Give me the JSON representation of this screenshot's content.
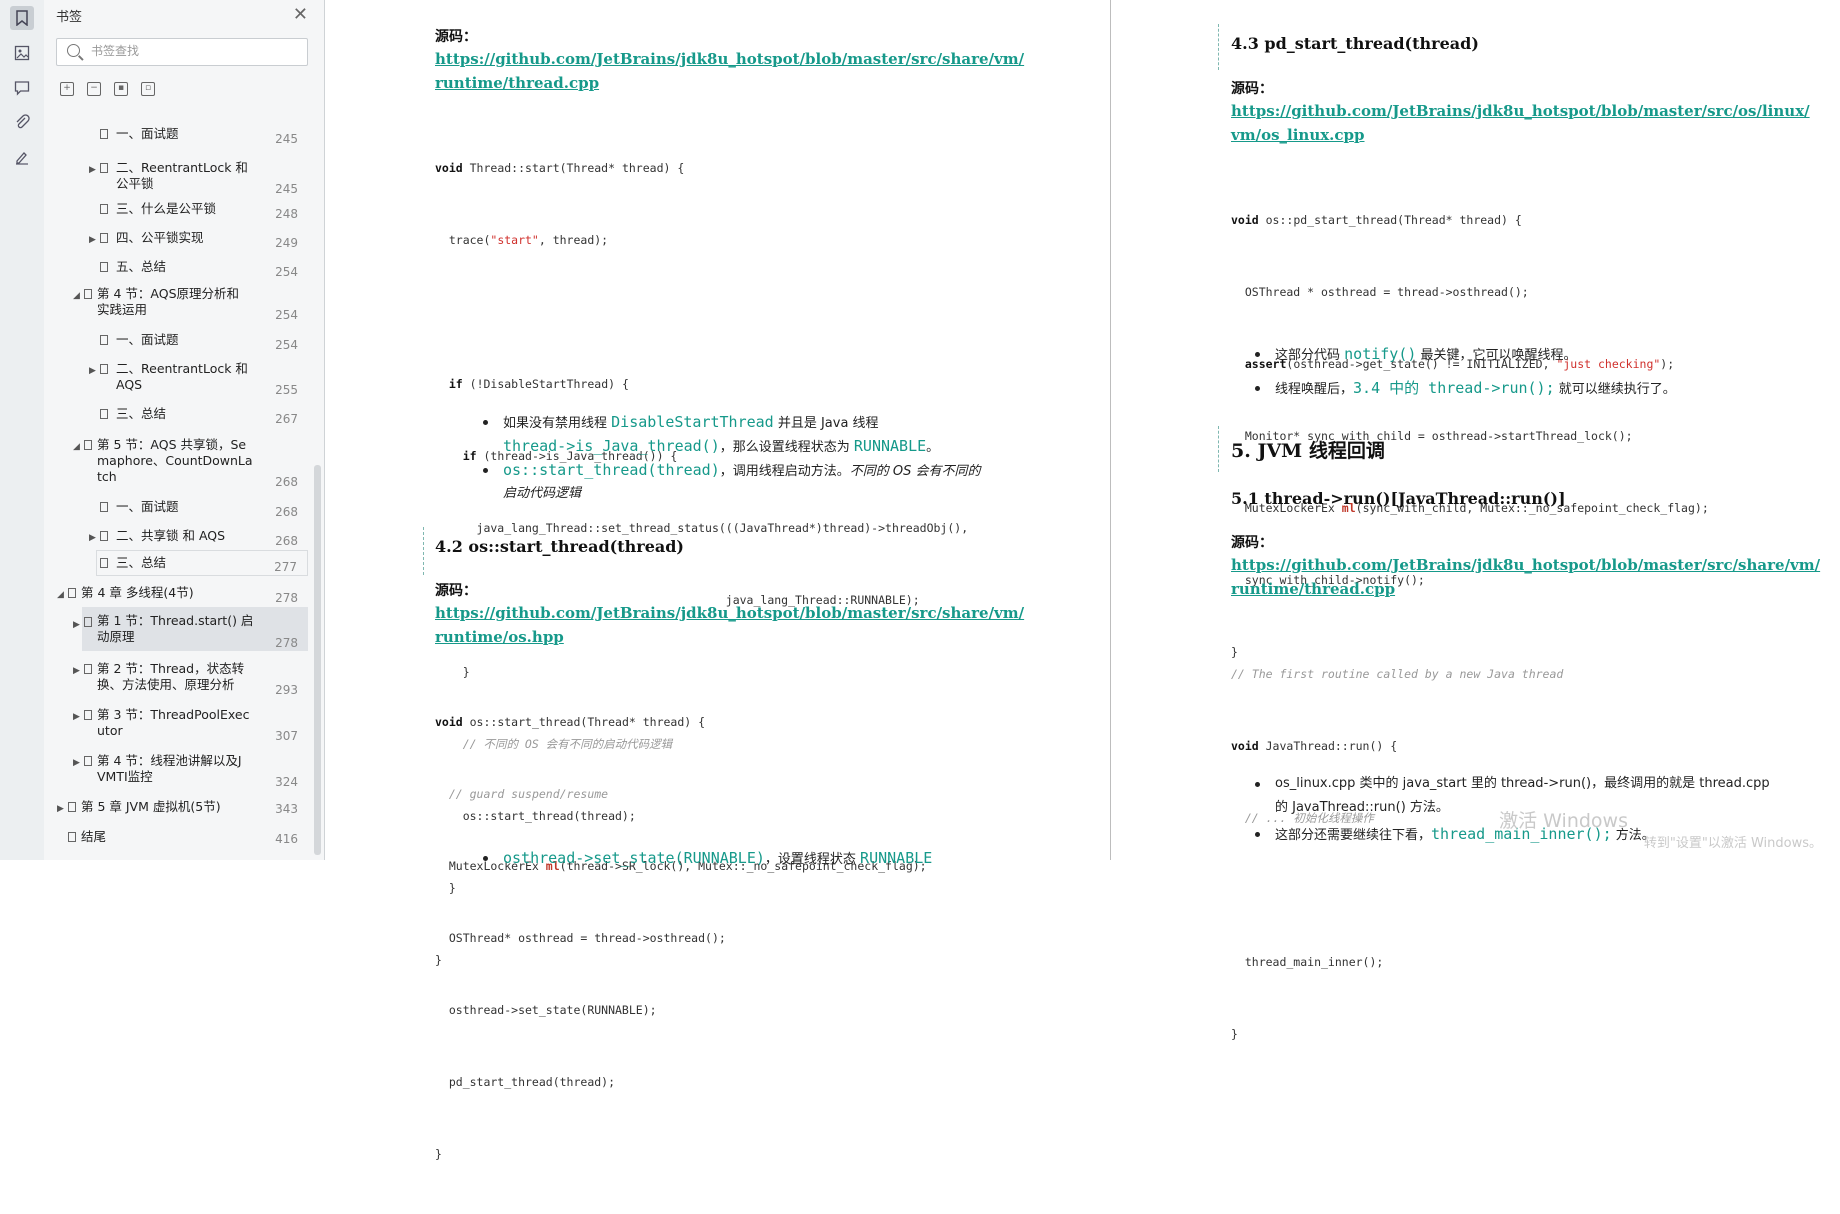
{
  "sidebar": {
    "title": "书签",
    "search_placeholder": "书签查找",
    "items": [
      {
        "label": "一、面试题",
        "page": "245"
      },
      {
        "label": "二、ReentrantLock 和\n公平锁",
        "page": "245"
      },
      {
        "label": "三、什么是公平锁",
        "page": "248"
      },
      {
        "label": "四、公平锁实现",
        "page": "249"
      },
      {
        "label": "五、总结",
        "page": "254"
      },
      {
        "label": "第 4 节：AQS原理分析和\n实践运用",
        "page": "254"
      },
      {
        "label": "一、面试题",
        "page": "254"
      },
      {
        "label": "二、ReentrantLock 和\nAQS",
        "page": "255"
      },
      {
        "label": "三、总结",
        "page": "267"
      },
      {
        "label": "第 5 节：AQS 共享锁，Se\nmaphore、CountDownLa\ntch",
        "page": "268"
      },
      {
        "label": "一、面试题",
        "page": "268"
      },
      {
        "label": "二、共享锁 和 AQS",
        "page": "268"
      },
      {
        "label": "三、总结",
        "page": "277"
      },
      {
        "label": "第 4 章 多线程(4节)",
        "page": "278"
      },
      {
        "label": "第 1 节：Thread.start() 启\n动原理",
        "page": "278"
      },
      {
        "label": "第 2 节：Thread，状态转\n换、方法使用、原理分析",
        "page": "293"
      },
      {
        "label": "第 3 节：ThreadPoolExec\nutor",
        "page": "307"
      },
      {
        "label": "第 4 节：线程池讲解以及J\nVMTI监控",
        "page": "324"
      },
      {
        "label": "第 5 章 JVM 虚拟机(5节)",
        "page": "343"
      },
      {
        "label": "结尾",
        "page": "416"
      }
    ]
  },
  "left": {
    "source_label": "源码：",
    "link1_l1": "https://github.com/JetBrains/jdk8u_hotspot/blob/master/src/share/vm/",
    "link1_l2": "runtime/thread.cpp",
    "code1": [
      "void Thread::start(Thread* thread) {",
      "  trace(\"start\", thread);",
      "",
      "  if (!DisableStartThread) {",
      "    if (thread->is_Java_thread()) {",
      "      java_lang_Thread::set_thread_status(((JavaThread*)thread)->threadObj(),",
      "                                          java_lang_Thread::RUNNABLE);",
      "    }",
      "    // 不同的 OS 会有不同的启动代码逻辑",
      "    os::start_thread(thread);",
      "  }",
      "}"
    ],
    "b1_a": "如果没有禁用线程 ",
    "b1_b": "DisableStartThread",
    "b1_c": " 并且是 Java 线程",
    "b1_d": "thread->is_Java_thread()",
    "b1_e": "，那么设置线程状态为 ",
    "b1_f": "RUNNABLE",
    "b1_g": "。",
    "b2_a": "os::start_thread(thread)",
    "b2_b": "，调用线程启动方法。",
    "b2_c": "不同的 OS 会有不同的",
    "b2_d": "启动代码逻辑",
    "h42": "4.2 os::start_thread(thread)",
    "source_label2": "源码：",
    "link2_l1": "https://github.com/JetBrains/jdk8u_hotspot/blob/master/src/share/vm/",
    "link2_l2": "runtime/os.hpp",
    "code2": [
      "void os::start_thread(Thread* thread) {",
      "  // guard suspend/resume",
      "  MutexLockerEx ml(thread->SR_lock(), Mutex::_no_safepoint_check_flag);",
      "  OSThread* osthread = thread->osthread();",
      "  osthread->set_state(RUNNABLE);",
      "  pd_start_thread(thread);",
      "}"
    ],
    "b3_a": "osthread->set_state(RUNNABLE)",
    "b3_b": "，设置线程状态 ",
    "b3_c": "RUNNABLE"
  },
  "right": {
    "h43": "4.3 pd_start_thread(thread)",
    "source_label": "源码：",
    "link1_l1": "https://github.com/JetBrains/jdk8u_hotspot/blob/master/src/os/linux/",
    "link1_l2": "vm/os_linux.cpp",
    "code1": [
      "void os::pd_start_thread(Thread* thread) {",
      "  OSThread * osthread = thread->osthread();",
      "  assert(osthread->get_state() != INITIALIZED, \"just checking\");",
      "  Monitor* sync_with_child = osthread->startThread_lock();",
      "  MutexLockerEx ml(sync_with_child, Mutex::_no_safepoint_check_flag);",
      "  sync_with_child->notify();",
      "}"
    ],
    "b1_a": "这部分代码 ",
    "b1_b": "notify()",
    "b1_c": " 最关键，它可以唤醒线程。",
    "b2_a": "线程唤醒后，",
    "b2_b": "3.4 中的 thread->run();",
    "b2_c": " 就可以继续执行了。",
    "h5": "5. JVM 线程回调",
    "h51": "5.1 thread->run()[JavaThread::run()]",
    "source_label2": "源码：",
    "link2_l1": "https://github.com/JetBrains/jdk8u_hotspot/blob/master/src/share/vm/",
    "link2_l2": "runtime/thread.cpp",
    "code2": [
      "// The first routine called by a new Java thread",
      "void JavaThread::run() {",
      "  // ... 初始化线程操作",
      "",
      "  thread_main_inner();",
      "}"
    ],
    "b3_l1": "os_linux.cpp  类中的  java_start  里的  thread->run()，最终调用的就是  thread.cpp",
    "b3_l2": "的  JavaThread::run()  方法。",
    "b4_a": "这部分还需要继续往下看，",
    "b4_b": "thread_main_inner();",
    "b4_c": " 方法。",
    "wm1": "激活 Windows",
    "wm2": "转到\"设置\"以激活 Windows。"
  }
}
